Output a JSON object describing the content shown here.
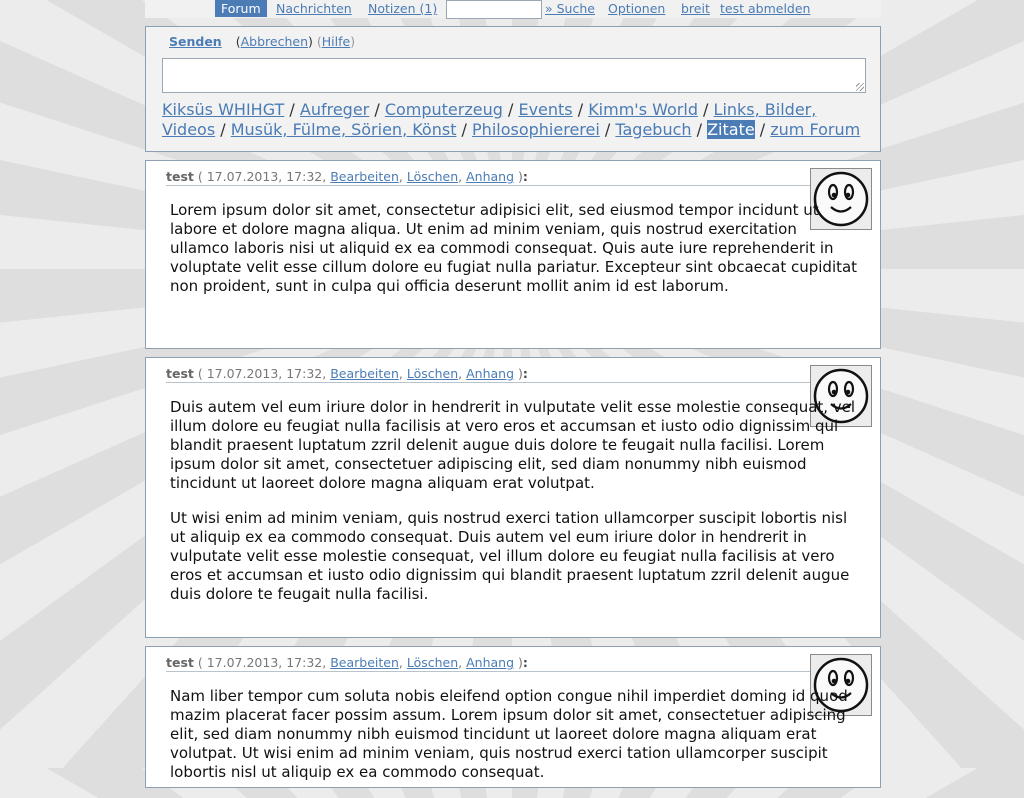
{
  "nav": {
    "forum": "Forum",
    "messages": "Nachrichten",
    "notes": "Notizen (1)",
    "search": "» Suche",
    "options": "Optionen",
    "wide": "breit",
    "logout": "test abmelden"
  },
  "form": {
    "send": "Senden",
    "cancel": "Abbrechen",
    "help": "Hilfe"
  },
  "categories": [
    "Kiksüs WHIHGT",
    "Aufreger",
    "Computerzeug",
    "Events",
    "Kimm's World",
    "Links, Bilder, Videos",
    "Musük, Fülme, Sörien, Könst",
    "Philosophiererei",
    "Tagebuch",
    "Zitate",
    "zum Forum"
  ],
  "posts": [
    {
      "author": "test",
      "date": "( 17.07.2013, 17:32,",
      "edit": "Bearbeiten",
      "delete": "Löschen",
      "attach": "Anhang",
      "close": ")",
      "colon": ":",
      "avatar_icon": "smiley-icon",
      "paragraphs": [
        "Lorem ipsum dolor sit amet, consectetur adipisici elit, sed eiusmod tempor incidunt ut labore et dolore magna aliqua. Ut enim ad minim veniam, quis nostrud exercitation ullamco laboris nisi ut aliquid ex ea commodi consequat. Quis aute iure reprehenderit in voluptate velit esse cillum dolore eu fugiat nulla pariatur. Excepteur sint obcaecat cupiditat non proident, sunt in culpa qui officia deserunt mollit anim id est laborum."
      ]
    },
    {
      "author": "test",
      "date": "( 17.07.2013, 17:32,",
      "edit": "Bearbeiten",
      "delete": "Löschen",
      "attach": "Anhang",
      "close": ")",
      "colon": ":",
      "avatar_icon": "smiley-icon",
      "paragraphs": [
        "Duis autem vel eum iriure dolor in hendrerit in vulputate velit esse molestie consequat, vel illum dolore eu feugiat nulla facilisis at vero eros et accumsan et iusto odio dignissim qui blandit praesent luptatum zzril delenit augue duis dolore te feugait nulla facilisi. Lorem ipsum dolor sit amet, consectetuer adipiscing elit, sed diam nonummy nibh euismod tincidunt ut laoreet dolore magna aliquam erat volutpat.",
        "Ut wisi enim ad minim veniam, quis nostrud exerci tation ullamcorper suscipit lobortis nisl ut aliquip ex ea commodo consequat. Duis autem vel eum iriure dolor in hendrerit in vulputate velit esse molestie consequat, vel illum dolore eu feugiat nulla facilisis at vero eros et accumsan et iusto odio dignissim qui blandit praesent luptatum zzril delenit augue duis dolore te feugait nulla facilisi."
      ]
    },
    {
      "author": "test",
      "date": "( 17.07.2013, 17:32,",
      "edit": "Bearbeiten",
      "delete": "Löschen",
      "attach": "Anhang",
      "close": ")",
      "colon": ":",
      "avatar_icon": "smiley-icon",
      "paragraphs": [
        "Nam liber tempor cum soluta nobis eleifend option congue nihil imperdiet doming id quod mazim placerat facer possim assum. Lorem ipsum dolor sit amet, consectetuer adipiscing elit, sed diam nonummy nibh euismod tincidunt ut laoreet dolore magna aliquam erat volutpat. Ut wisi enim ad minim veniam, quis nostrud exerci tation ullamcorper suscipit lobortis nisl ut aliquip ex ea commodo consequat."
      ]
    }
  ]
}
